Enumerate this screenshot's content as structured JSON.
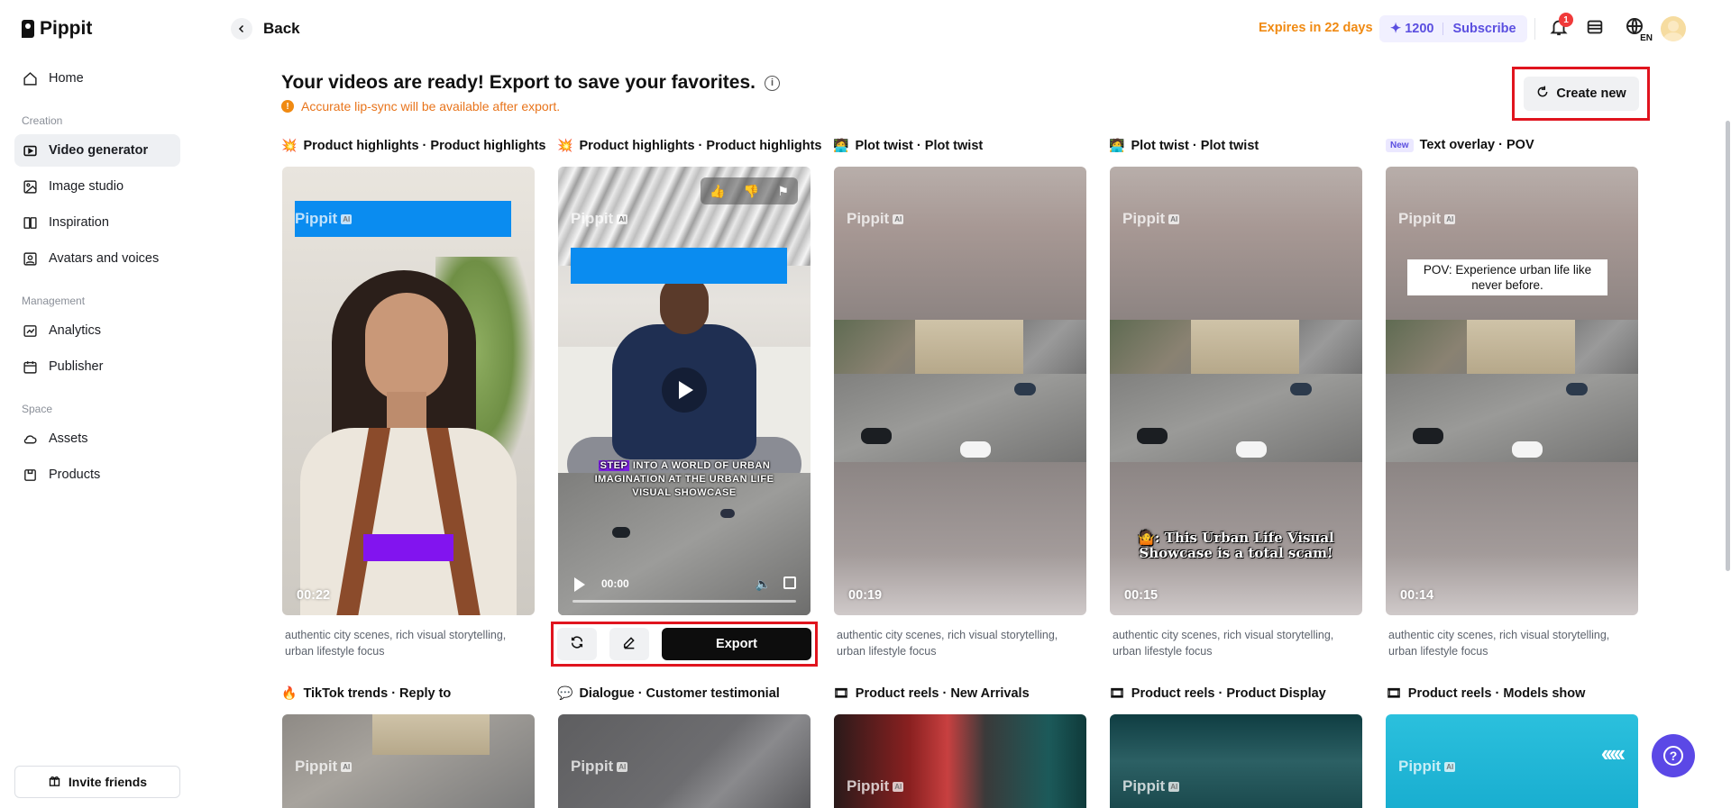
{
  "app": {
    "name": "Pippit"
  },
  "sidebar": {
    "home": "Home",
    "sections": {
      "creation": "Creation",
      "management": "Management",
      "space": "Space"
    },
    "items": {
      "video_generator": "Video generator",
      "image_studio": "Image studio",
      "inspiration": "Inspiration",
      "avatars": "Avatars and voices",
      "analytics": "Analytics",
      "publisher": "Publisher",
      "assets": "Assets",
      "products": "Products"
    },
    "invite": "Invite friends"
  },
  "header": {
    "back": "Back",
    "expires": "Expires in 22 days",
    "credits": "1200",
    "subscribe": "Subscribe",
    "notification_count": "1",
    "lang": "EN"
  },
  "main": {
    "heading": "Your videos are ready! Export to save your favorites.",
    "notice": "Accurate lip-sync will be available after export.",
    "create_new": "Create new",
    "watermark": "Pippit",
    "watermark_ai": "AI",
    "export_label": "Export",
    "cards": [
      {
        "title": "Product highlights · Product highlights",
        "emoji": "💥",
        "duration": "00:22",
        "desc": "authentic city scenes, rich visual storytelling, urban lifestyle focus"
      },
      {
        "title": "Product highlights · Product highlights",
        "emoji": "💥",
        "time": "00:00",
        "caption_hl": "STEP",
        "caption_rest": " INTO A WORLD OF URBAN IMAGINATION AT THE URBAN LIFE VISUAL SHOWCASE"
      },
      {
        "title": "Plot twist · Plot twist",
        "emoji": "🧑‍💻",
        "duration": "00:19",
        "desc": "authentic city scenes, rich visual storytelling, urban lifestyle focus"
      },
      {
        "title": "Plot twist · Plot twist",
        "emoji": "🧑‍💻",
        "duration": "00:15",
        "desc": "authentic city scenes, rich visual storytelling, urban lifestyle focus",
        "caption": "🤷: This Urban Life Visual Showcase is a total scam!"
      },
      {
        "title": "Text overlay · POV",
        "tag": "New",
        "duration": "00:14",
        "desc": "authentic city scenes, rich visual storytelling, urban lifestyle focus",
        "caption": "POV: Experience urban life like never before."
      }
    ],
    "card2_desc": "",
    "row2": [
      {
        "title": "TikTok trends · Reply to",
        "emoji": "🔥"
      },
      {
        "title": "Dialogue · Customer testimonial",
        "emoji": "💬"
      },
      {
        "title": "Product reels · New Arrivals",
        "emoji": "🎞"
      },
      {
        "title": "Product reels · Product Display",
        "emoji": "🎞"
      },
      {
        "title": "Product reels · Models show",
        "emoji": "🎞"
      }
    ]
  },
  "icons": {
    "home": "home-icon",
    "video": "video-icon",
    "image": "image-icon",
    "inspiration": "book-icon",
    "avatars": "avatar-icon",
    "analytics": "chart-icon",
    "publisher": "calendar-icon",
    "assets": "cloud-icon",
    "products": "box-icon",
    "bell": "bell-icon",
    "layers": "layers-icon",
    "globe": "globe-icon",
    "help": "help-icon"
  },
  "colors": {
    "accent": "#5b4fe0",
    "warning": "#f08a12",
    "highlight_border": "#e0141e"
  }
}
